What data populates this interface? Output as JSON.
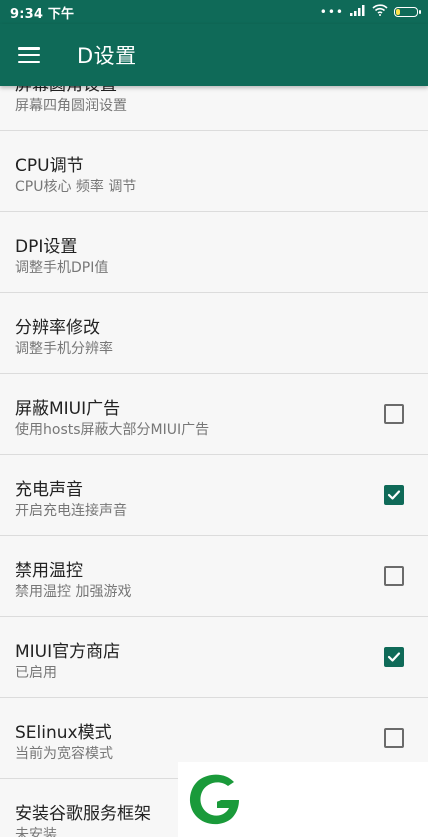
{
  "status_bar": {
    "time": "9:34 下午",
    "signal_dots": "•••",
    "battery_level": 0.18
  },
  "app_bar": {
    "title": "D设置"
  },
  "items": [
    {
      "title": "屏幕圆角设置",
      "subtitle": "屏幕四角圆润设置",
      "has_checkbox": false
    },
    {
      "title": "CPU调节",
      "subtitle": "CPU核心 频率 调节",
      "has_checkbox": false
    },
    {
      "title": "DPI设置",
      "subtitle": "调整手机DPI值",
      "has_checkbox": false
    },
    {
      "title": "分辨率修改",
      "subtitle": "调整手机分辨率",
      "has_checkbox": false
    },
    {
      "title": "屏蔽MIUI广告",
      "subtitle": "使用hosts屏蔽大部分MIUI广告",
      "has_checkbox": true,
      "checked": false
    },
    {
      "title": "充电声音",
      "subtitle": "开启充电连接声音",
      "has_checkbox": true,
      "checked": true
    },
    {
      "title": "禁用温控",
      "subtitle": "禁用温控 加强游戏",
      "has_checkbox": true,
      "checked": false
    },
    {
      "title": "MIUI官方商店",
      "subtitle": "已启用",
      "has_checkbox": true,
      "checked": true
    },
    {
      "title": "SElinux模式",
      "subtitle": "当前为宽容模式",
      "has_checkbox": true,
      "checked": false
    },
    {
      "title": "安装谷歌服务框架",
      "subtitle": "未安装",
      "has_checkbox": false
    }
  ],
  "colors": {
    "primary": "#0f6a58",
    "checkbox_checked": "#0f6a58",
    "logo_green": "#1a9a3a"
  }
}
